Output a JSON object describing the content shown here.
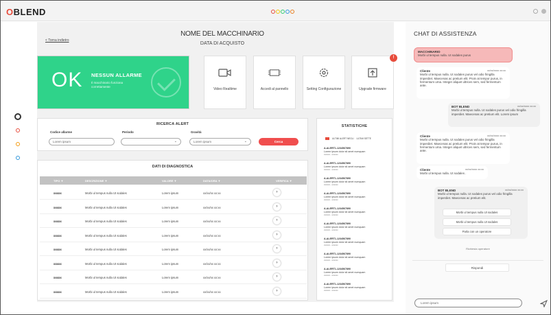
{
  "header": {
    "logo": "BLEND",
    "logo_prefix": "O",
    "center_logo_colors": [
      "#e74c3c",
      "#f1c40f",
      "#2ecc71",
      "#3498db",
      "#e67e22"
    ]
  },
  "rail": {
    "icons": [
      "circle-icon",
      "red-circle-icon",
      "orange-circle-icon",
      "blue-circle-icon"
    ]
  },
  "main": {
    "back_link": "< Torna indietro",
    "machine_name": "NOME DEL MACCHINARIO",
    "purchase_date": "DATA DI ACQUISTO",
    "status": {
      "big": "OK",
      "title": "NESSUN ALLARME",
      "subtitle": "Il macchinario funziona correttamente"
    },
    "tiles": [
      {
        "icon": "video-icon",
        "label": "Video Realtime"
      },
      {
        "icon": "panel-icon",
        "label": "Accedi al pannello"
      },
      {
        "icon": "settings-icon",
        "label": "Setting Configurazione"
      },
      {
        "icon": "upgrade-icon",
        "label": "Upgrade firmware"
      }
    ],
    "badge_count": "!",
    "search": {
      "title": "RICERCA ALERT",
      "code_label": "Codice allarme",
      "code_placeholder": "Lorem ipsum",
      "period_label": "Periodo",
      "period_value": "",
      "severity_label": "Gravità",
      "severity_value": "Lorem ipsum",
      "button": "Cerca"
    },
    "stats": {
      "title": "STATISTICHE",
      "tab_1": "ULTIMI ALERT NEGLI",
      "tab_2": "ULTIMI SETTE",
      "items": [
        {
          "code": "A-ALERT1-1234567890",
          "desc": "Lorem ipsum dolor sit amet numquam",
          "tag": "xxxxxx - xxxxxx"
        },
        {
          "code": "A-ALERT1-1234567890",
          "desc": "Lorem ipsum dolor sit amet numquam",
          "tag": "xxxxxx - xxxxxx"
        },
        {
          "code": "A-ALERT1-1234567890",
          "desc": "Lorem ipsum dolor sit amet numquam",
          "tag": "xxxxxx - xxxxxx"
        },
        {
          "code": "A-ALERT1-1234567890",
          "desc": "Lorem ipsum dolor sit amet numquam",
          "tag": "xxxxxx - xxxxxx"
        },
        {
          "code": "A-ALERT1-1234567890",
          "desc": "Lorem ipsum dolor sit amet numquam",
          "tag": "xxxxxx - xxxxxx"
        },
        {
          "code": "A-ALERT1-1234567890",
          "desc": "Lorem ipsum dolor sit amet numquam",
          "tag": "xxxxxx - xxxxxx"
        },
        {
          "code": "A-ALERT1-1234567890",
          "desc": "Lorem ipsum dolor sit amet numquam",
          "tag": "xxxxxx - xxxxxx"
        },
        {
          "code": "A-ALERT1-1234567890",
          "desc": "Lorem ipsum dolor sit amet numquam",
          "tag": "xxxxxx - xxxxxx"
        },
        {
          "code": "A-ALERT1-1234567890",
          "desc": "Lorem ipsum dolor sit amet numquam",
          "tag": "xxxxxx - xxxxxx"
        },
        {
          "code": "A-ALERT1-1234567890",
          "desc": "Lorem ipsum dolor sit amet numquam",
          "tag": "xxxxxx - xxxxxx"
        }
      ]
    },
    "diagnostic": {
      "title": "DATI DI DIAGNOSTICA",
      "columns": [
        "TIPO ▼",
        "DESCRIZIONE ▼",
        "VALORE ▼",
        "DATA/ORA ▼",
        "VERIFICA ▼"
      ],
      "rows": [
        {
          "tipo": "xxxxx",
          "desc": "Morbi ul tempus nulla Ut sodales",
          "valore": "Lorem ipsum",
          "data": "xx/xx/xx xx:xx",
          "verify": "›"
        },
        {
          "tipo": "xxxxx",
          "desc": "Morbi ul tempus nulla Ut sodales",
          "valore": "Lorem ipsum",
          "data": "xx/xx/xx xx:xx",
          "verify": "›"
        },
        {
          "tipo": "xxxxx",
          "desc": "Morbi ul tempus nulla Ut sodales",
          "valore": "Lorem ipsum",
          "data": "xx/xx/xx xx:xx",
          "verify": "›"
        },
        {
          "tipo": "xxxxx",
          "desc": "Morbi ul tempus nulla Ut sodales",
          "valore": "Lorem ipsum",
          "data": "xx/xx/xx xx:xx",
          "verify": "›"
        },
        {
          "tipo": "xxxxx",
          "desc": "Morbi ul tempus nulla Ut sodales",
          "valore": "Lorem ipsum",
          "data": "xx/xx/xx xx:xx",
          "verify": "›"
        },
        {
          "tipo": "xxxxx",
          "desc": "Morbi ul tempus nulla Ut sodales",
          "valore": "Lorem ipsum",
          "data": "xx/xx/xx xx:xx",
          "verify": "›"
        },
        {
          "tipo": "xxxxx",
          "desc": "Morbi ul tempus nulla Ut sodales",
          "valore": "Lorem ipsum",
          "data": "xx/xx/xx xx:xx",
          "verify": "›"
        },
        {
          "tipo": "xxxxx",
          "desc": "Morbi ul tempus nulla Ut sodales",
          "valore": "Lorem ipsum",
          "data": "xx/xx/xx xx:xx",
          "verify": "›"
        }
      ]
    }
  },
  "chat": {
    "title": "CHAT DI ASSISTENZA",
    "machine_label": "MACCHINARIO",
    "machine_text": "Morbi ul tempus nulla. Ut sodales purus",
    "messages": [
      {
        "who": "Cliente",
        "time": "xx/xx/xxxx xx:xx",
        "text": "Morbi ul tempus nulla. Ut sodales purus vel odio fringilla imperdiet. Maecenas ac pretium elit. Proin at tempor purus, in fermentum urna. Integer aliquet ultrices sem, sed fermentum ante."
      },
      {
        "who": "BOT BLEND",
        "time": "xx/xx/xxxx xx:xx",
        "text": "Morbi ul tempus nulla. Ut sodales purus vel odio fringilla imperdiet. Maecenas ac pretium elit. Lorem ipsum"
      },
      {
        "who": "Cliente",
        "time": "xx/xx/xxxx xx:xx",
        "text": "Morbi ul tempus nulla. Ut sodales purus vel odio fringilla imperdiet. Maecenas ac pretium elit. Proin at tempor purus, in fermentum urna. Integer aliquet ultrices sem, sed fermentum ante."
      },
      {
        "who": "Cliente",
        "time": "xx/xx/xxxx xx:xx",
        "text": "Morbi ul tempus nulla. Ut sodales ."
      },
      {
        "who": "BOT BLEND",
        "time": "xx/xx/xxxx xx:xx",
        "text": "Morbi ul tempus nulla. Ut sodales purus vel odio fringilla imperdiet. Maecenas ac pretium elit."
      }
    ],
    "options": [
      "Morbi ul tempus nulla Ut sodales",
      "Morbi ul tempus nulla Ut sodales",
      "Parla con un operatore"
    ],
    "note": "Richiesta operatore",
    "reply_button": "Rispondi",
    "input_placeholder": "Lorem ipsum"
  }
}
